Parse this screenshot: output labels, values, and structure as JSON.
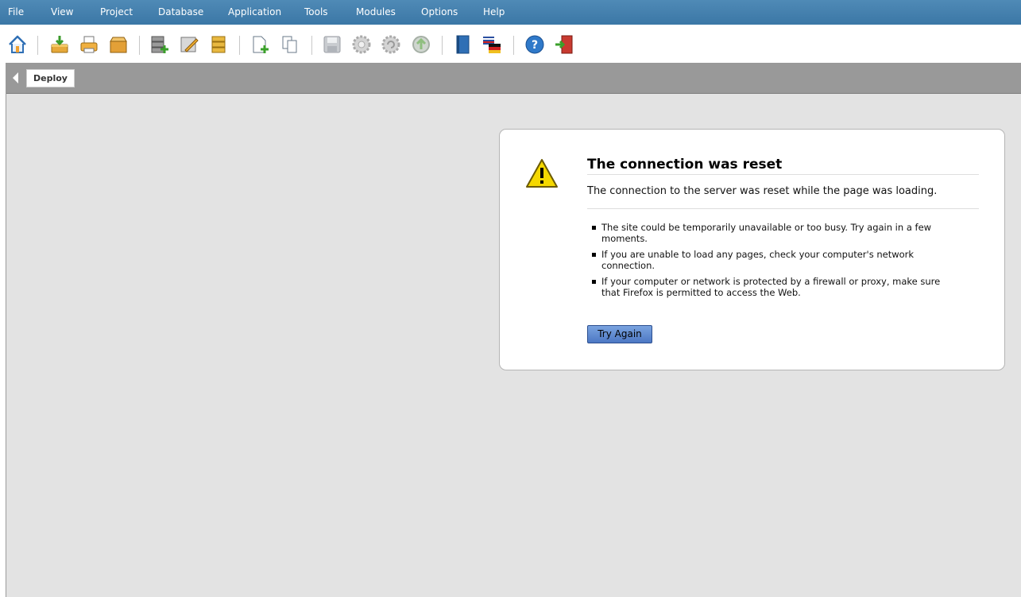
{
  "menubar": {
    "items": [
      "File",
      "View",
      "Project",
      "Database",
      "Application",
      "Tools",
      "Modules",
      "Options",
      "Help"
    ]
  },
  "toolbar": {
    "icons": [
      "home-icon",
      "install-icon",
      "print-icon",
      "package-icon",
      "add-database-icon",
      "edit-database-icon",
      "database-icon",
      "new-page-icon",
      "copy-page-icon",
      "save-icon",
      "settings-icon",
      "refresh-icon",
      "upload-icon",
      "book-icon",
      "language-flag-icon",
      "help-icon",
      "exit-icon"
    ]
  },
  "tabbar": {
    "tab_label": "Deploy"
  },
  "error": {
    "title": "The connection was reset",
    "description": "The connection to the server was reset while the page was loading.",
    "bullets": [
      "The site could be temporarily unavailable or too busy. Try again in a few moments.",
      "If you are unable to load any pages, check your computer's network connection.",
      "If your computer or network is protected by a firewall or proxy, make sure that Firefox is permitted to access the Web."
    ],
    "button_label": "Try Again"
  },
  "colors": {
    "menubar": "#3b77a6",
    "content_bg": "#e3e3e3",
    "tabbar": "#999999",
    "button": "#5a84cc"
  }
}
